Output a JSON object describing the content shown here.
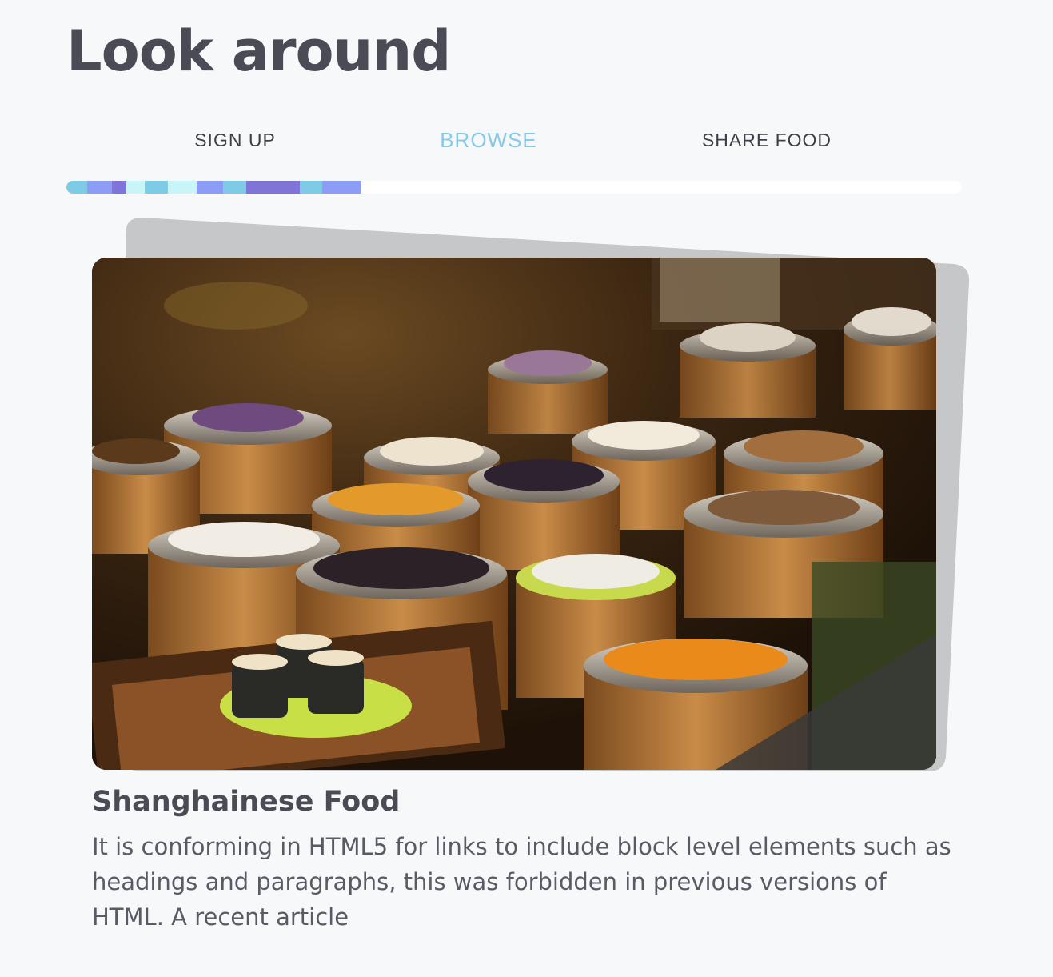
{
  "page": {
    "title": "Look around"
  },
  "tabs": [
    {
      "label": "SIGN UP",
      "active": false
    },
    {
      "label": "BROWSE",
      "active": true
    },
    {
      "label": "SHARE FOOD",
      "active": false
    }
  ],
  "progress": {
    "fraction": 0.33,
    "track_color": "#ffffff",
    "segment_colors": [
      "#7ecbe6",
      "#8d9cf4",
      "#7f74d8",
      "#c8f6f8",
      "#7ecbe6",
      "#c8f6f8",
      "#8d9cf4",
      "#7ecbe6",
      "#7f74d8",
      "#7ecbe6",
      "#8d9cf4"
    ]
  },
  "card": {
    "image_alt": "bamboo steamers of dim sum",
    "title": "Shanghainese Food",
    "description": "It is conforming in HTML5 for links to include block level elements such as headings and paragraphs, this was forbidden in previous versions of HTML. A recent article"
  },
  "colors": {
    "background": "#f7f8fa",
    "text": "#4b4b55",
    "accent": "#87c9e6",
    "card_shadow": "#c6c7c9"
  }
}
